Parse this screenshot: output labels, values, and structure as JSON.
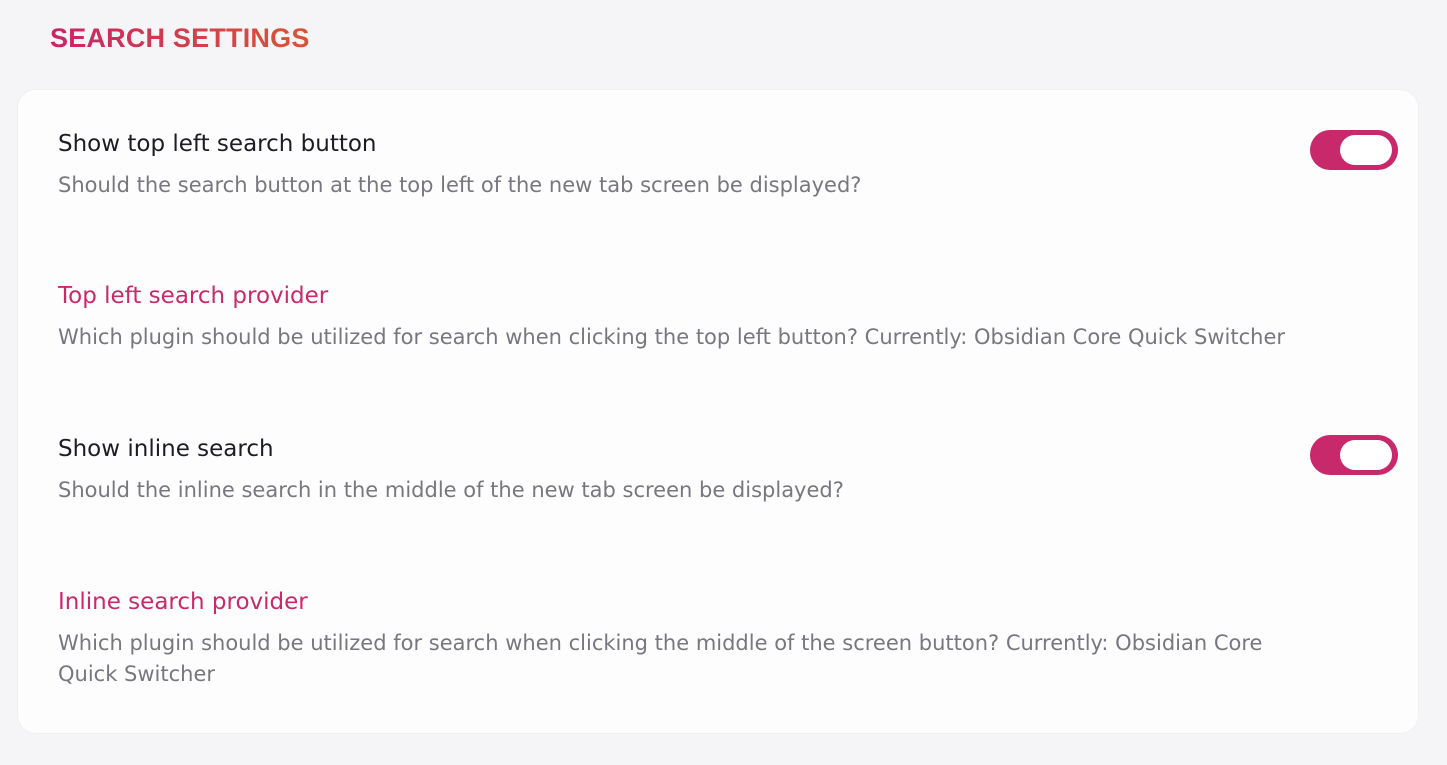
{
  "section": {
    "title": "SEARCH SETTINGS"
  },
  "colors": {
    "accent": "#c8296a",
    "title_gradient_start": "#cc2366",
    "title_gradient_end": "#d95535",
    "text_primary": "#1c1c22",
    "text_secondary": "#77777e",
    "background": "#f5f5f7",
    "card": "#fdfdfd"
  },
  "settings": [
    {
      "title": "Show top left search button",
      "description": "Should the search button at the top left of the new tab screen be displayed?",
      "control": "toggle",
      "enabled": true
    },
    {
      "title": "Top left search provider",
      "description": "Which plugin should be utilized for search when clicking the top left button? Currently: Obsidian Core Quick Switcher",
      "control": "link"
    },
    {
      "title": "Show inline search",
      "description": "Should the inline search in the middle of the new tab screen be displayed?",
      "control": "toggle",
      "enabled": true
    },
    {
      "title": "Inline search provider",
      "description": "Which plugin should be utilized for search when clicking the middle of the screen button? Currently: Obsidian Core Quick Switcher",
      "control": "link"
    }
  ]
}
